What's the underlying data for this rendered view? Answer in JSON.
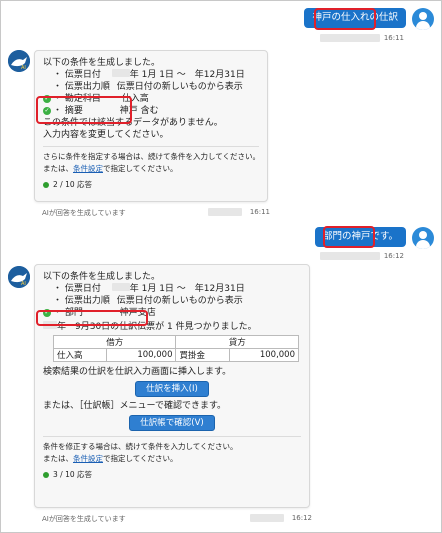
{
  "colors": {
    "user_bubble": "#1a73c9",
    "check": "#3cb043",
    "highlight": "#e0202a"
  },
  "conv1": {
    "user_text": "神戸の仕入れの仕訳",
    "user_time": "16:11",
    "bot": {
      "intro": "以下の条件を生成しました。",
      "date_label": "・ 伝票日付",
      "date_value": "年 1月 1日 ～　年12月31日",
      "order_label": "・ 伝票出力順",
      "order_value": "伝票日付の新しいものから表示",
      "cond1_label": "・ 勘定科目",
      "cond1_value": "仕入高",
      "cond2_label": "・ 摘要",
      "cond2_value": "神戸 含む",
      "nodata1": "この条件では該当するデータがありません。",
      "nodata2": "入力内容を変更してください。",
      "footer1": "さらに条件を指定する場合は、続けて条件を入力してください。",
      "footer2_pre": "または、",
      "footer2_link": "条件設定",
      "footer2_post": "で指定してください。",
      "count": "2 / 10 応答"
    },
    "bot_status": "AIが回答を生成しています",
    "bot_time": "16:11"
  },
  "conv2": {
    "user_text": "部門の神戸です。",
    "user_time": "16:12",
    "bot": {
      "intro": "以下の条件を生成しました。",
      "date_label": "・ 伝票日付",
      "date_value": "年 1月 1日 ～　年12月31日",
      "order_label": "・ 伝票出力順",
      "order_value": "伝票日付の新しいものから表示",
      "cond1_label": "・ 部門",
      "cond1_value": "神戸支店",
      "found": "年　9月30日の仕訳伝票が 1 件見つかりました。",
      "table": {
        "debit_header": "借方",
        "credit_header": "貸方",
        "debit_account": "仕入高",
        "debit_amount": "100,000",
        "credit_account": "買掛金",
        "credit_amount": "100,000"
      },
      "insert_msg": "検索結果の仕訳を仕訳入力画面に挿入します。",
      "insert_btn": "仕訳を挿入(I)",
      "or_msg": "または、［仕訳帳］メニューで確認できます。",
      "confirm_btn": "仕訳帳で確認(V)",
      "footer1": "条件を修正する場合は、続けて条件を入力してください。",
      "footer2_pre": "または、",
      "footer2_link": "条件設定",
      "footer2_post": "で指定してください。",
      "count": "3 / 10 応答"
    },
    "bot_status": "AIが回答を生成しています",
    "bot_time": "16:12"
  }
}
